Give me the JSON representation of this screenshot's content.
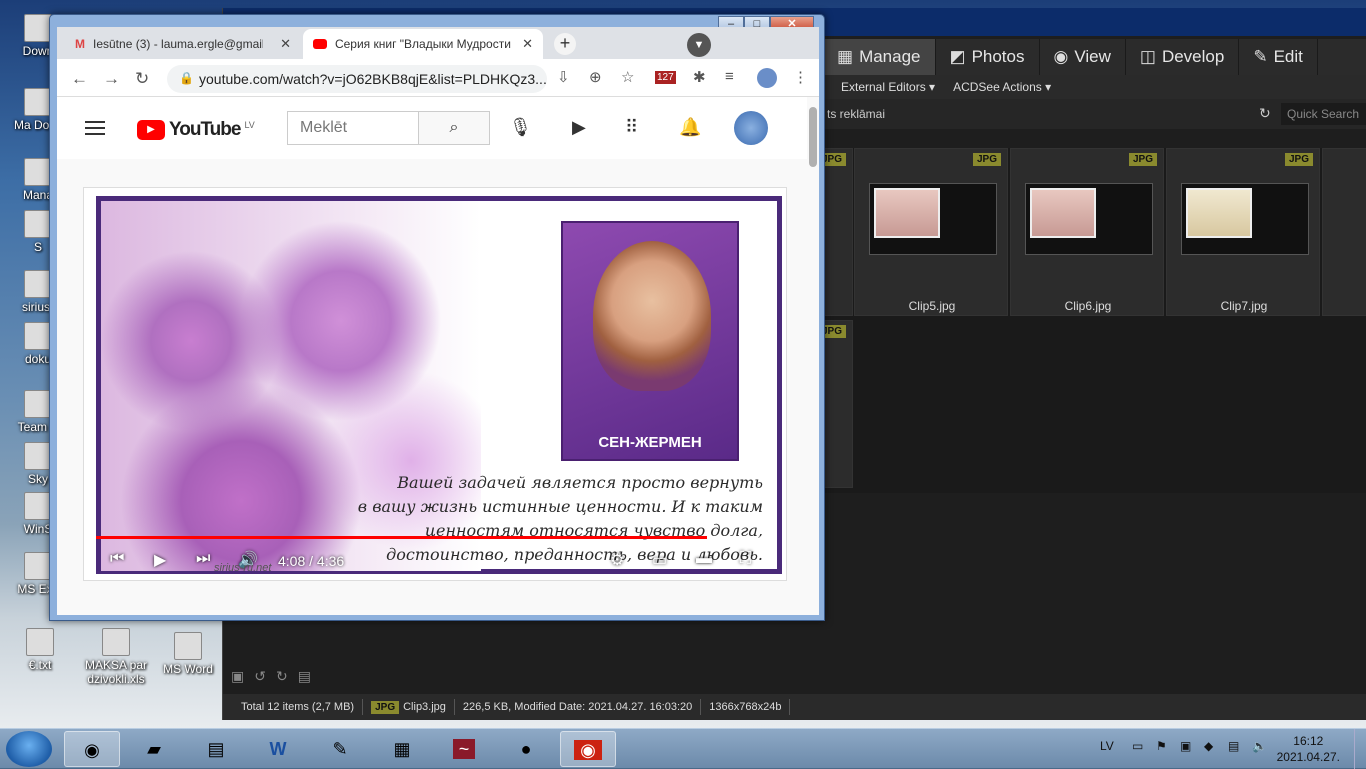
{
  "desktop_icons": [
    {
      "label": "Down"
    },
    {
      "label": "Ma Doku"
    },
    {
      "label": "Mana"
    },
    {
      "label": "S"
    },
    {
      "label": "sirius-"
    },
    {
      "label": "doku"
    },
    {
      "label": "Team V"
    },
    {
      "label": "Sky"
    },
    {
      "label": "WinS"
    },
    {
      "label": "MS Exc"
    },
    {
      "label": "€.txt"
    },
    {
      "label": "MAKSA par dzivokli.xls"
    },
    {
      "label": "MS Word"
    }
  ],
  "acdsee": {
    "modes": [
      {
        "label": "Manage",
        "icon": "grid-icon"
      },
      {
        "label": "Photos",
        "icon": "photos-icon"
      },
      {
        "label": "View",
        "icon": "eye-icon"
      },
      {
        "label": "Develop",
        "icon": "develop-icon"
      },
      {
        "label": "Edit",
        "icon": "edit-icon"
      }
    ],
    "menu": [
      "External Editors ▾",
      "ACDSee Actions ▾"
    ],
    "breadcrumb": "ts reklāmai",
    "quick_search_placeholder": "Quick Search",
    "tiles": [
      {
        "badge": "JPG",
        "name": "Clip5.jpg"
      },
      {
        "badge": "JPG",
        "name": "Clip6.jpg"
      },
      {
        "badge": "JPG",
        "name": "Clip7.jpg"
      }
    ],
    "partial_badges": [
      "JPG",
      "JPG"
    ],
    "status": {
      "total": "Total 12 items  (2,7 MB)",
      "badge": "JPG",
      "file": "Clip3.jpg",
      "info": "226,5 KB, Modified Date: 2021.04.27. 16:03:20",
      "dims": "1366x768x24b"
    }
  },
  "chrome": {
    "tabs": [
      {
        "title": "Iesūtne (3) - lauma.ergle@gmail.c",
        "icon": "gmail-icon"
      },
      {
        "title": "Серия книг \"Владыки Мудрости",
        "icon": "youtube-icon"
      }
    ],
    "url": "youtube.com/watch?v=jO62BKB8qjE&list=PLDHKQz3...",
    "badge_count": "127"
  },
  "youtube": {
    "logo": "YouTube",
    "country": "LV",
    "search_placeholder": "Meklēt",
    "book_title": "СЕН-ЖЕРМЕН",
    "quote_lines": [
      "Вашей задачей является просто вернуть",
      "в вашу жизнь истинные ценности. И к таким",
      "ценностям относятся чувство долга,",
      "достоинство, преданность, вера и любовь."
    ],
    "watermark": "sirius-ru.net",
    "time": "4:08 / 4:36",
    "progress": 0.899
  },
  "taskbar": {
    "lang": "LV",
    "time": "16:12",
    "date": "2021.04.27."
  }
}
